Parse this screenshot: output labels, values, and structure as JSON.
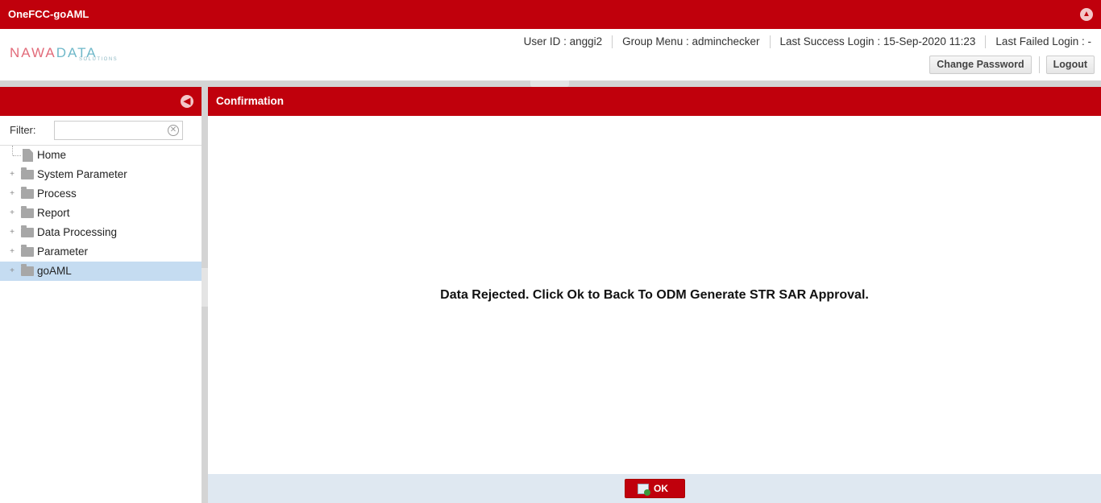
{
  "app": {
    "title": "OneFCC-goAML"
  },
  "logo": {
    "main_a": "NAWA",
    "main_b": "DATA",
    "sub": "SOLUTIONS"
  },
  "header": {
    "user_id": "User ID : anggi2",
    "group_menu": "Group Menu : adminchecker",
    "last_success": "Last Success Login : 15-Sep-2020 11:23",
    "last_failed": "Last Failed Login : -",
    "change_password_label": "Change Password",
    "logout_label": "Logout"
  },
  "sidebar": {
    "filter_label": "Filter:",
    "filter_value": "",
    "items": [
      {
        "label": "Home",
        "icon": "page-icon",
        "expandable": false
      },
      {
        "label": "System Parameter",
        "icon": "folder-icon",
        "expandable": true
      },
      {
        "label": "Process",
        "icon": "folder-icon",
        "expandable": true
      },
      {
        "label": "Report",
        "icon": "folder-icon",
        "expandable": true
      },
      {
        "label": "Data Processing",
        "icon": "folder-icon",
        "expandable": true
      },
      {
        "label": "Parameter",
        "icon": "folder-icon",
        "expandable": true
      },
      {
        "label": "goAML",
        "icon": "folder-icon",
        "expandable": true,
        "selected": true
      }
    ]
  },
  "main": {
    "panel_title": "Confirmation",
    "message": "Data Rejected. Click Ok to Back To ODM Generate STR SAR Approval.",
    "ok_label": "OK"
  },
  "colors": {
    "brand": "#c0000c",
    "selected": "#c5dcf1",
    "footer": "#dfe8f1"
  }
}
